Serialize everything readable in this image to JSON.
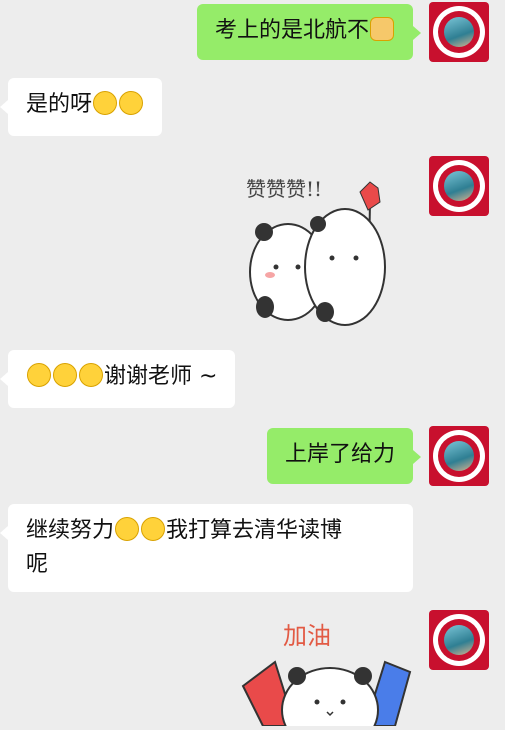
{
  "messages": [
    {
      "side": "right",
      "text": "考上的是北航不",
      "emoji": [
        "dog-face"
      ]
    },
    {
      "side": "left",
      "text": "是的呀",
      "emoji": [
        "grin",
        "grin"
      ]
    },
    {
      "side": "right",
      "sticker": "panda-thumbs-up",
      "sticker_text": "赞赞赞!!"
    },
    {
      "side": "left",
      "text": "谢谢老师 ~",
      "emoji_before": [
        "tearful",
        "tearful",
        "tearful"
      ]
    },
    {
      "side": "right",
      "text": "上岸了给力"
    },
    {
      "side": "left",
      "text_line1": "继续努力",
      "text_after_emoji": "我打算去清华读博",
      "text_line2": "呢",
      "emoji": [
        "strong-face",
        "strong-face"
      ]
    },
    {
      "side": "right",
      "sticker": "panda-cheer",
      "sticker_text": "加油"
    }
  ]
}
